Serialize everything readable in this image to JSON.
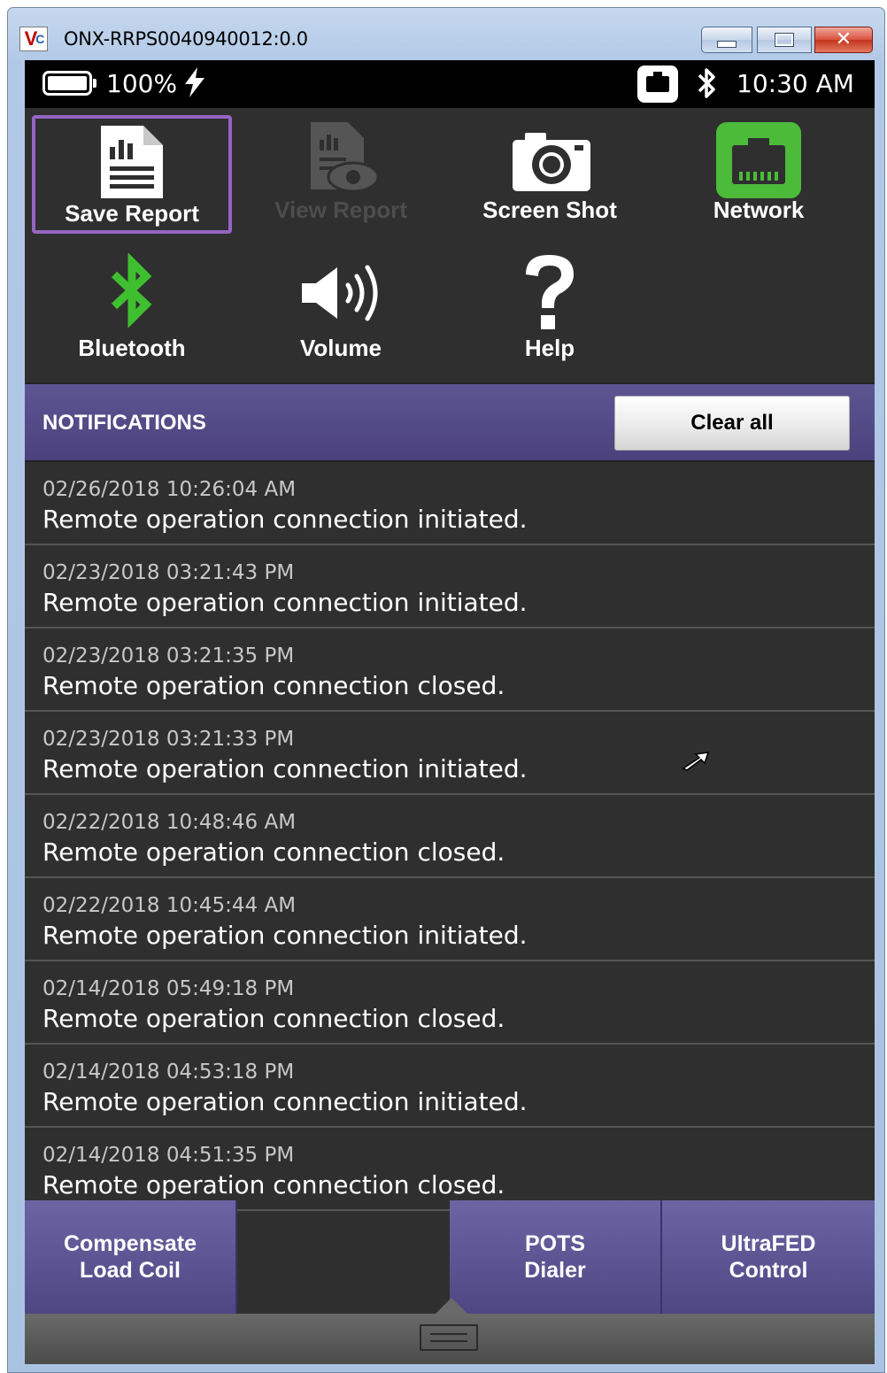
{
  "window": {
    "title": "ONX-RRPS0040940012:0.0",
    "icon_text": "V",
    "icon_sub": "C"
  },
  "status_bar": {
    "battery_percent": "100%",
    "battery_level": 1.0,
    "charging": true,
    "time": "10:30 AM",
    "icons": [
      "battery-icon",
      "charging-bolt-icon",
      "ethernet-icon",
      "bluetooth-icon"
    ]
  },
  "quick_actions": [
    {
      "label": "Save Report",
      "icon": "report-document-icon",
      "state": "selected"
    },
    {
      "label": "View Report",
      "icon": "view-report-icon",
      "state": "disabled"
    },
    {
      "label": "Screen Shot",
      "icon": "camera-icon",
      "state": "normal"
    },
    {
      "label": "Network",
      "icon": "ethernet-icon",
      "state": "active"
    },
    {
      "label": "Bluetooth",
      "icon": "bluetooth-icon",
      "state": "active"
    },
    {
      "label": "Volume",
      "icon": "speaker-icon",
      "state": "normal"
    },
    {
      "label": "Help",
      "icon": "question-mark-icon",
      "state": "normal"
    }
  ],
  "notifications": {
    "title": "NOTIFICATIONS",
    "clear_label": "Clear all",
    "items": [
      {
        "time": "02/26/2018 10:26:04 AM",
        "message": "Remote operation connection initiated."
      },
      {
        "time": "02/23/2018 03:21:43 PM",
        "message": "Remote operation connection initiated."
      },
      {
        "time": "02/23/2018 03:21:35 PM",
        "message": "Remote operation connection closed."
      },
      {
        "time": "02/23/2018 03:21:33 PM",
        "message": "Remote operation connection initiated."
      },
      {
        "time": "02/22/2018 10:48:46 AM",
        "message": "Remote operation connection closed."
      },
      {
        "time": "02/22/2018 10:45:44 AM",
        "message": "Remote operation connection initiated."
      },
      {
        "time": "02/14/2018 05:49:18 PM",
        "message": "Remote operation connection closed."
      },
      {
        "time": "02/14/2018 04:53:18 PM",
        "message": "Remote operation connection initiated."
      },
      {
        "time": "02/14/2018 04:51:35 PM",
        "message": "Remote operation connection closed."
      }
    ]
  },
  "shortcuts": [
    {
      "line1": "Compensate",
      "line2": "Load Coil"
    },
    {
      "line1": "POTS",
      "line2": "Dialer"
    },
    {
      "line1": "UltraFED",
      "line2": "Control"
    }
  ],
  "colors": {
    "accent_purple": "#9564c4",
    "network_green": "#4cbb3a",
    "bluetooth_green": "#3fbf2f",
    "header_purple": "#5d5592"
  }
}
